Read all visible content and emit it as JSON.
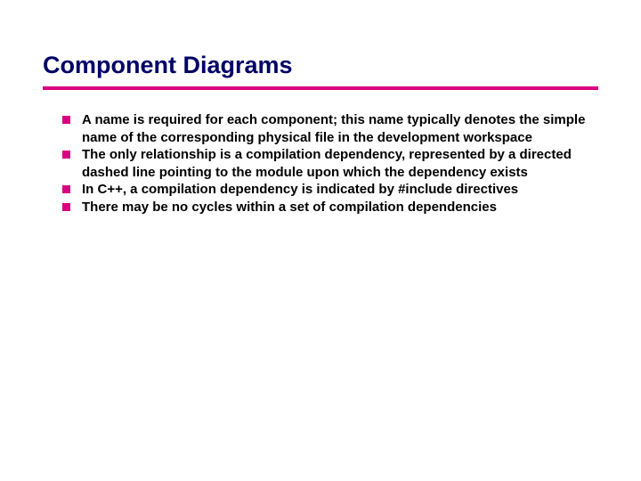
{
  "title": "Component Diagrams",
  "bullets": [
    "A name is required for each component; this name typically denotes the simple name of the corresponding physical file in the development workspace",
    "The only relationship is a compilation dependency, represented by a directed dashed line pointing to the module upon which the dependency exists",
    "In C++, a compilation dependency is indicated by #include directives",
    "There may be no cycles within a set of compilation dependencies"
  ],
  "colors": {
    "accent": "#d80080",
    "title": "#000066"
  }
}
